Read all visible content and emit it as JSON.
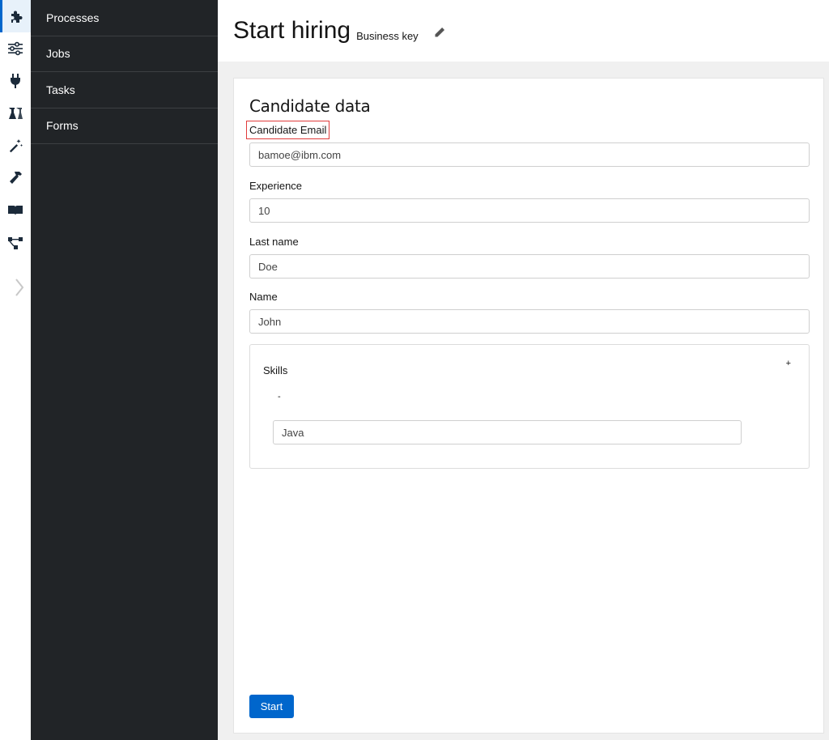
{
  "rail": {
    "icons": [
      "puzzle-icon",
      "sliders-icon",
      "plug-icon",
      "flask-icon",
      "magic-wand-icon",
      "hammer-icon",
      "book-icon",
      "topology-icon"
    ],
    "expand_icon": "chevron-right-icon"
  },
  "sidebar": {
    "items": [
      {
        "label": "Processes"
      },
      {
        "label": "Jobs"
      },
      {
        "label": "Tasks"
      },
      {
        "label": "Forms"
      }
    ]
  },
  "header": {
    "title": "Start hiring",
    "business_key_label": "Business key",
    "edit_icon": "pencil-icon"
  },
  "form": {
    "section_title": "Candidate data",
    "fields": [
      {
        "label": "Candidate Email",
        "value": "bamoe@ibm.com"
      },
      {
        "label": "Experience",
        "value": "10"
      },
      {
        "label": "Last name",
        "value": "Doe"
      },
      {
        "label": "Name",
        "value": "John"
      }
    ],
    "skills": {
      "title": "Skills",
      "add_label": "+",
      "remove_label": "-",
      "items": [
        {
          "value": "Java"
        }
      ]
    },
    "submit_label": "Start"
  },
  "colors": {
    "sidebar_bg": "#212427",
    "primary": "#0066cc",
    "highlight": "#e03b3b",
    "page_bg": "#f0f0f0"
  }
}
